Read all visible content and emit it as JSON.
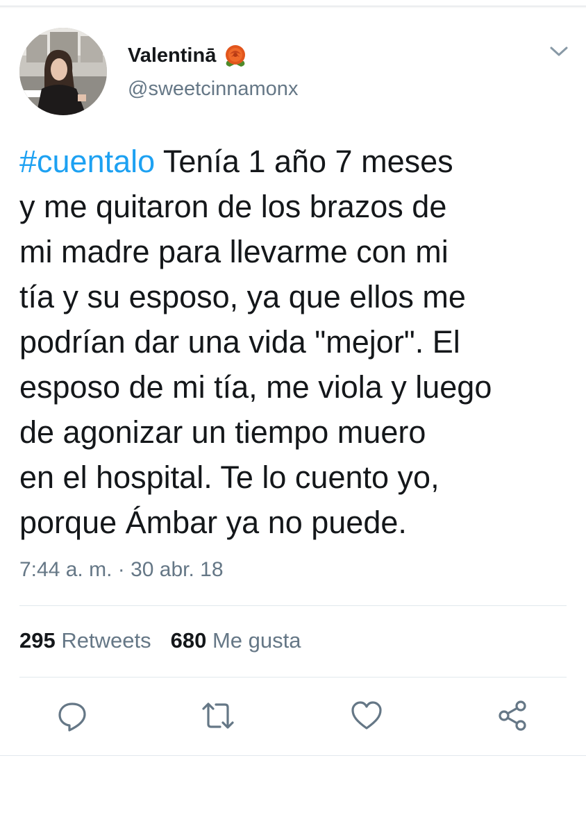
{
  "tweet": {
    "author": {
      "display_name": "Valentinā",
      "name_emoji": "rose-icon",
      "handle": "@sweetcinnamonx"
    },
    "text": {
      "hashtag": "#cuentalo",
      "first_line_rest": " Tenía 1 año 7 meses",
      "lines": [
        "y me quitaron de los brazos de",
        "mi madre para llevarme con mi",
        "tía y su esposo, ya que ellos me",
        "podrían dar una vida \"mejor\". El",
        "esposo de mi tía, me viola y luego",
        "de agonizar un tiempo muero",
        "en el hospital. Te lo cuento yo,",
        "porque Ámbar ya no puede."
      ]
    },
    "timestamp": "7:44 a. m. · 30 abr. 18",
    "stats": {
      "retweets_count": "295",
      "retweets_label": "Retweets",
      "likes_count": "680",
      "likes_label": "Me gusta"
    },
    "actions": [
      "reply-icon",
      "retweet-icon",
      "like-icon",
      "share-icon"
    ]
  },
  "colors": {
    "hashtag": "#1da1f2",
    "secondary_text": "#657786",
    "primary_text": "#14171a",
    "divider": "#e1e8ed"
  }
}
